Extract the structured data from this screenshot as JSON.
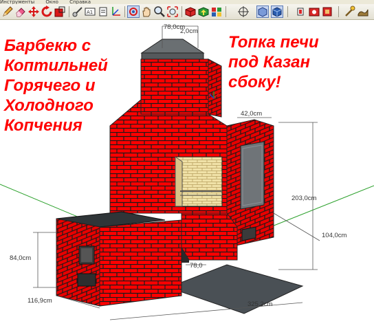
{
  "menubar": {
    "items": [
      "Инструменты",
      "Окно",
      "Справка"
    ]
  },
  "toolbar": {
    "tools": [
      {
        "icon": "pencil-icon",
        "label": "Карандаш"
      },
      {
        "icon": "eraser-icon",
        "label": "Ластик"
      },
      {
        "icon": "move-icon",
        "label": "Переместить"
      },
      {
        "icon": "rotate-icon",
        "label": "Повернуть"
      },
      {
        "icon": "scale-icon",
        "label": "Масштаб"
      },
      {
        "icon": "tape-measure-icon",
        "label": "Рулетка"
      },
      {
        "icon": "dimension-icon",
        "label": "Размер"
      },
      {
        "icon": "text-icon",
        "label": "Текст"
      },
      {
        "icon": "axes-icon",
        "label": "Оси"
      },
      {
        "icon": "orbit-icon",
        "label": "Орбита"
      },
      {
        "icon": "pan-icon",
        "label": "Панорама"
      },
      {
        "icon": "zoom-icon",
        "label": "Лупа"
      },
      {
        "icon": "zoom-extents-icon",
        "label": "Показать все"
      },
      {
        "icon": "get-models-icon",
        "label": "Получить модели"
      },
      {
        "icon": "share-model-icon",
        "label": "Поделиться моделью"
      },
      {
        "icon": "components-icon",
        "label": "Компоненты"
      },
      {
        "icon": "section-plane-icon",
        "label": "Секущая плоскость"
      },
      {
        "icon": "xray-icon",
        "label": "Рентген"
      },
      {
        "icon": "shaded-textures-icon",
        "label": "Текстуры"
      },
      {
        "icon": "walk-icon",
        "label": "Обход"
      },
      {
        "icon": "look-around-icon",
        "label": "Осмотреться"
      },
      {
        "icon": "position-camera-icon",
        "label": "Камера"
      },
      {
        "icon": "geolocation-icon",
        "label": "Геопозиция"
      },
      {
        "icon": "sandbox-icon",
        "label": "Песочница"
      }
    ]
  },
  "captions": {
    "left": [
      "Барбекю с",
      "Коптильней",
      "Горячего и",
      "Холодного",
      "Копчения"
    ],
    "right": [
      "Топка печи",
      "под Казан",
      "сбоку!"
    ]
  },
  "dimensions": {
    "chimney_width": "78,0cm",
    "chimney_depth": "2,0cm",
    "side_width": "42,0cm",
    "total_height": "203,0cm",
    "side_depth": "104,0cm",
    "stove_height": "84,0cm",
    "stove_width": "116,9cm",
    "total_width": "325,2cm",
    "gap_width": "78,0"
  },
  "colors": {
    "brick": "#ff0000",
    "mortar": "#1a1a1a",
    "firebox": "#e8d9a0",
    "metal": "#6f7478",
    "ground": "#4a5055",
    "caption": "#ff0000",
    "toolbar_bg": "#ece9d8"
  }
}
